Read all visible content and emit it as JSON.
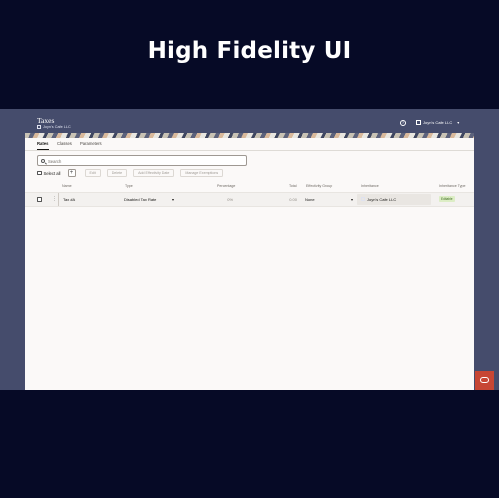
{
  "hero": {
    "title": "High Fidelity UI"
  },
  "header": {
    "title": "Taxes",
    "company": "Joyn's Cafe LLC",
    "help_icon": "help-circle-icon",
    "switcher_label": "Joyn's Cafe LLC",
    "switcher_icon": "building-icon"
  },
  "tabs": [
    {
      "label": "Rates",
      "active": true
    },
    {
      "label": "Classes",
      "active": false
    },
    {
      "label": "Parameters",
      "active": false
    }
  ],
  "search": {
    "placeholder": "Search",
    "value": ""
  },
  "toolbar": {
    "select_all": "Select all",
    "add_icon": "plus-icon",
    "edit": "Edit",
    "delete": "Delete",
    "add_effectivity": "Add Effectivity Date",
    "manage_exemptions": "Manage Exemptions"
  },
  "columns": {
    "name": "Name",
    "type": "Type",
    "percentage": "Percentage",
    "total": "Total",
    "effectivity": "Effectivity Group",
    "inheritance": "Inheritance",
    "inheritance_type": "Inheritance Type"
  },
  "rows": [
    {
      "name": "Tax #A",
      "type": "Disabled Tax Rate",
      "percentage": "0%",
      "total": "0.00",
      "effectivity": "None",
      "inheritance": "Joyn's Cafe LLC",
      "inheritance_type": "Editable"
    }
  ],
  "colors": {
    "background": "#060a26",
    "app_header": "#454c6c",
    "panel": "#fbf9f8",
    "badge_bg": "#dcedc5",
    "badge_text": "#3d6b1f",
    "fab": "#c74634"
  },
  "fab": {
    "icon": "oracle-chat-icon"
  }
}
